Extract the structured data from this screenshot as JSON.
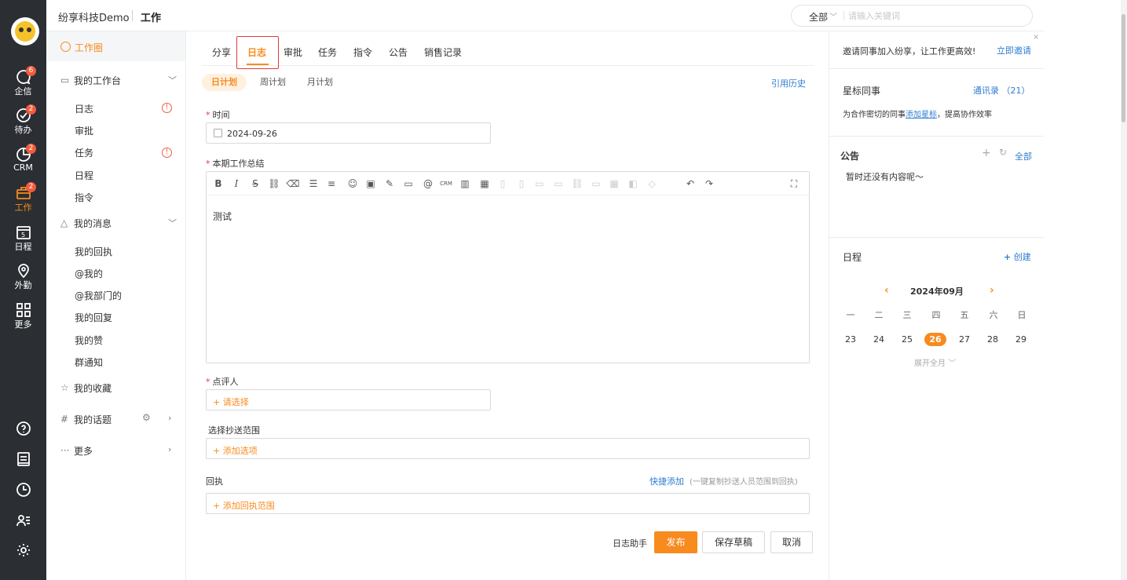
{
  "rail": {
    "items": [
      {
        "label": "企信",
        "badge": "6"
      },
      {
        "label": "待办",
        "badge": "2"
      },
      {
        "label": "CRM",
        "badge": "2"
      },
      {
        "label": "工作",
        "badge": "2"
      },
      {
        "label": "日程",
        "badge": "",
        "day": "5"
      },
      {
        "label": "外勤",
        "badge": ""
      },
      {
        "label": "更多",
        "badge": ""
      }
    ]
  },
  "topbar": {
    "company": "纷享科技Demo",
    "section": "工作",
    "search_scope": "全部",
    "search_placeholder": "请输入关键词"
  },
  "nav": {
    "home": "工作圈",
    "workbench": "我的工作台",
    "workbench_items": [
      {
        "label": "日志",
        "alert": "!"
      },
      {
        "label": "审批",
        "alert": ""
      },
      {
        "label": "任务",
        "alert": "!"
      },
      {
        "label": "日程",
        "alert": ""
      },
      {
        "label": "指令",
        "alert": ""
      }
    ],
    "messages": "我的消息",
    "message_items": [
      "我的回执",
      "@我的",
      "@我部门的",
      "我的回复",
      "我的赞",
      "群通知"
    ],
    "favorites": "我的收藏",
    "topics": "我的话题",
    "more": "更多"
  },
  "main": {
    "tabs": [
      "分享",
      "日志",
      "审批",
      "任务",
      "指令",
      "公告",
      "销售记录"
    ],
    "subtabs": [
      "日计划",
      "周计划",
      "月计划"
    ],
    "ref_history": "引用历史",
    "time_label": "时间",
    "date_value": "2024-09-26",
    "summary_label": "本期工作总结",
    "editor_content": "测试",
    "reviewer_label": "点评人",
    "reviewer_placeholder": "+ 请选择",
    "cc_label": "选择抄送范围",
    "cc_placeholder": "+ 添加选项",
    "receipt_label": "回执",
    "quick_add": "快捷添加",
    "quick_hint": "(一键复制抄送人员范围到回执)",
    "receipt_placeholder": "+ 添加回执范围",
    "assistant": "日志助手",
    "publish": "发布",
    "save_draft": "保存草稿",
    "cancel": "取消"
  },
  "right": {
    "close": "×",
    "invite_text": "邀请同事加入纷享，让工作更高效!",
    "invite_link": "立即邀请",
    "star_title": "星标同事",
    "contacts_link": "通讯录 （21）",
    "star_hint_pre": "为合作密切的同事",
    "star_hint_link": "添加星标",
    "star_hint_post": "，提高协作效率",
    "notice_title": "公告",
    "notice_all": "全部",
    "notice_empty": "暂时还没有内容呢～",
    "schedule_title": "日程",
    "schedule_create": "创建",
    "calendar_month": "2024年09月",
    "weekdays": [
      "一",
      "二",
      "三",
      "四",
      "五",
      "六",
      "日"
    ],
    "days": [
      "23",
      "24",
      "25",
      "26",
      "27",
      "28",
      "29"
    ],
    "today": "26",
    "expand": "展开全月"
  }
}
